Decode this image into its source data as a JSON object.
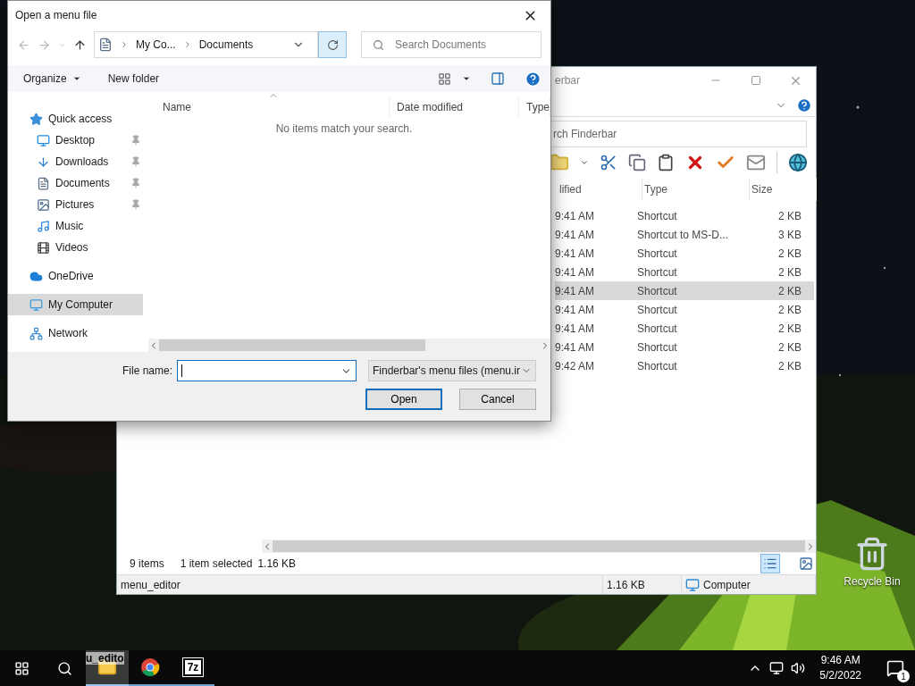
{
  "desktop": {
    "icons": [
      {
        "label": "Recycle Bin"
      }
    ]
  },
  "explorer": {
    "title": "erbar",
    "search": {
      "placeholder": "rch Finderbar"
    },
    "columns": [
      "lified",
      "Type",
      "Size"
    ],
    "rows": [
      {
        "date": "9:41 AM",
        "type": "Shortcut",
        "size": "2 KB",
        "selected": false
      },
      {
        "date": "9:41 AM",
        "type": "Shortcut to MS-D...",
        "size": "3 KB",
        "selected": false
      },
      {
        "date": "9:41 AM",
        "type": "Shortcut",
        "size": "2 KB",
        "selected": false
      },
      {
        "date": "9:41 AM",
        "type": "Shortcut",
        "size": "2 KB",
        "selected": false
      },
      {
        "date": "9:41 AM",
        "type": "Shortcut",
        "size": "2 KB",
        "selected": true
      },
      {
        "date": "9:41 AM",
        "type": "Shortcut",
        "size": "2 KB",
        "selected": false
      },
      {
        "date": "9:41 AM",
        "type": "Shortcut",
        "size": "2 KB",
        "selected": false
      },
      {
        "date": "9:41 AM",
        "type": "Shortcut",
        "size": "2 KB",
        "selected": false
      },
      {
        "date": "9:42 AM",
        "type": "Shortcut",
        "size": "2 KB",
        "selected": false
      }
    ],
    "status": {
      "items": "9 items",
      "selection": "1 item selected",
      "size": "1.16 KB"
    },
    "details_bar": {
      "name": "menu_editor",
      "size": "1.16 KB",
      "location": "Computer"
    }
  },
  "dialog": {
    "title": "Open a menu file",
    "breadcrumb": [
      "My Co...",
      "Documents"
    ],
    "search": {
      "placeholder": "Search Documents"
    },
    "toolbar": {
      "organize": "Organize",
      "new_folder": "New folder"
    },
    "nav": [
      {
        "label": "Quick access",
        "kind": "star",
        "selected": false,
        "children": [
          {
            "label": "Desktop",
            "kind": "desktop",
            "pinned": true,
            "selected": false
          },
          {
            "label": "Downloads",
            "kind": "download",
            "pinned": true,
            "selected": false
          },
          {
            "label": "Documents",
            "kind": "document",
            "pinned": true,
            "selected": false
          },
          {
            "label": "Pictures",
            "kind": "pictures",
            "pinned": true,
            "selected": false
          },
          {
            "label": "Music",
            "kind": "music",
            "pinned": false,
            "selected": false
          },
          {
            "label": "Videos",
            "kind": "videos",
            "pinned": false,
            "selected": false
          }
        ]
      },
      {
        "label": "OneDrive",
        "kind": "cloud",
        "selected": false
      },
      {
        "label": "My Computer",
        "kind": "computer",
        "selected": true
      },
      {
        "label": "Network",
        "kind": "network",
        "selected": false
      }
    ],
    "columns": [
      "Name",
      "Date modified",
      "Type"
    ],
    "empty_message": "No items match your search.",
    "file_name": {
      "label": "File name:"
    },
    "filter": "Finderbar's menu files (menu.ir",
    "buttons": [
      {
        "label": "Open",
        "default": true
      },
      {
        "label": "Cancel",
        "default": false
      }
    ]
  },
  "taskbar": {
    "drag_label": "u_edito",
    "apps": [
      {
        "kind": "explorer",
        "active": true
      },
      {
        "kind": "chrome",
        "active": false
      },
      {
        "kind": "sevenzip",
        "logo": "7z",
        "active": false
      }
    ],
    "clock": {
      "time": "9:46 AM",
      "date": "5/2/2022"
    },
    "notifications": "1"
  }
}
